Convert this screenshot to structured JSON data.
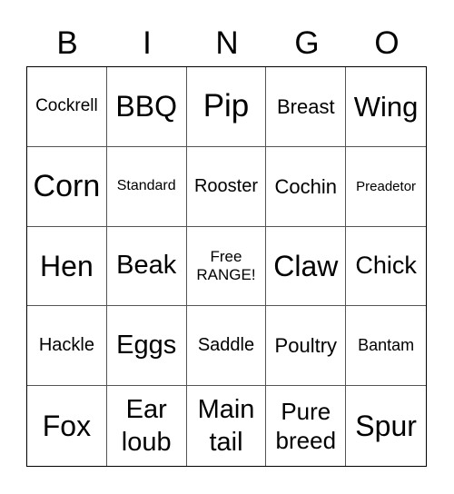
{
  "header": [
    "B",
    "I",
    "N",
    "G",
    "O"
  ],
  "cells": [
    "Cockrell",
    "BBQ",
    "Pip",
    "Breast",
    "Wing",
    "Corn",
    "Standard",
    "Rooster",
    "Cochin",
    "Preadetor",
    "Hen",
    "Beak",
    "Free\nRANGE!",
    "Claw",
    "Chick",
    "Hackle",
    "Eggs",
    "Saddle",
    "Poultry",
    "Bantam",
    "Fox",
    "Ear\nloub",
    "Main\ntail",
    "Pure\nbreed",
    "Spur"
  ]
}
